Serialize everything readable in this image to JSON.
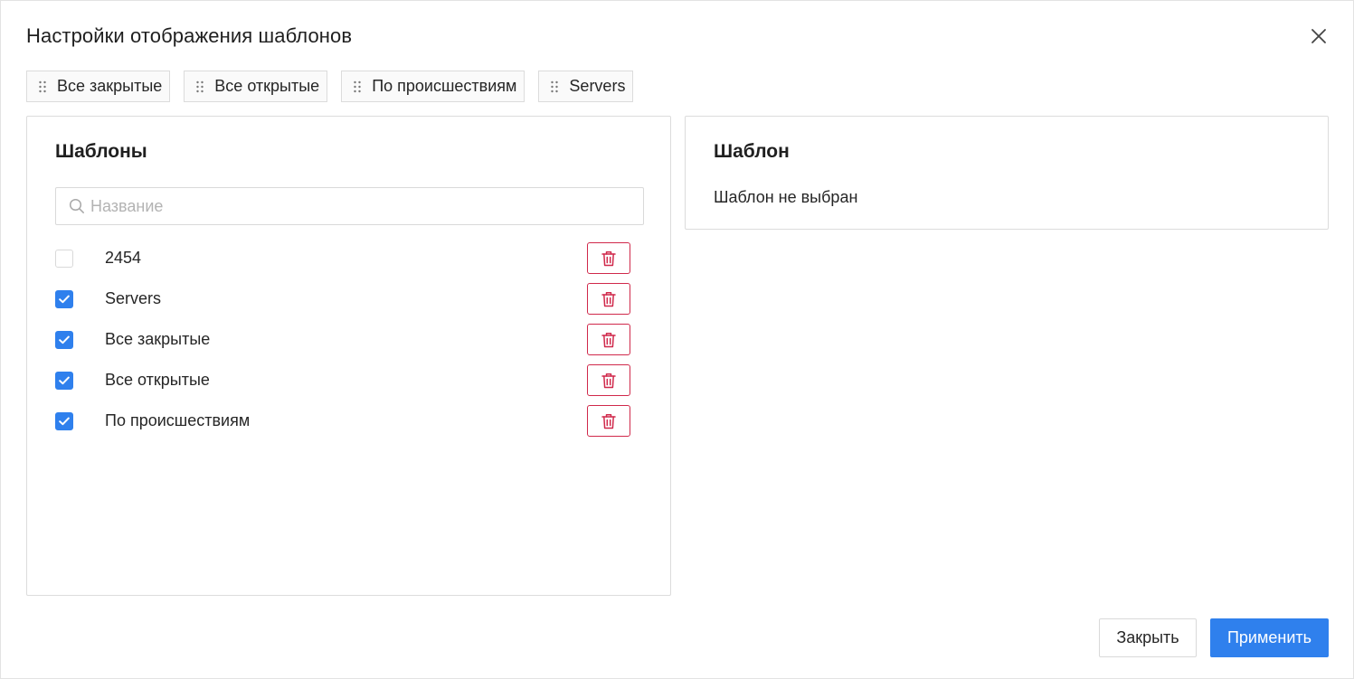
{
  "dialog": {
    "title": "Настройки отображения шаблонов",
    "close_icon": "close-icon"
  },
  "chips": [
    {
      "label": "Все закрытые"
    },
    {
      "label": "Все открытые"
    },
    {
      "label": "По происшествиям"
    },
    {
      "label": "Servers"
    }
  ],
  "templates_panel": {
    "title": "Шаблоны",
    "search": {
      "placeholder": "Название",
      "value": ""
    },
    "items": [
      {
        "label": "2454",
        "checked": false
      },
      {
        "label": "Servers",
        "checked": true
      },
      {
        "label": "Все закрытые",
        "checked": true
      },
      {
        "label": "Все открытые",
        "checked": true
      },
      {
        "label": "По происшествиям",
        "checked": true
      }
    ]
  },
  "template_panel": {
    "title": "Шаблон",
    "empty_text": "Шаблон не выбран"
  },
  "footer": {
    "close_label": "Закрыть",
    "apply_label": "Применить"
  },
  "colors": {
    "accent": "#2f80ed",
    "danger": "#d0294b",
    "border": "#dcdcdc"
  }
}
